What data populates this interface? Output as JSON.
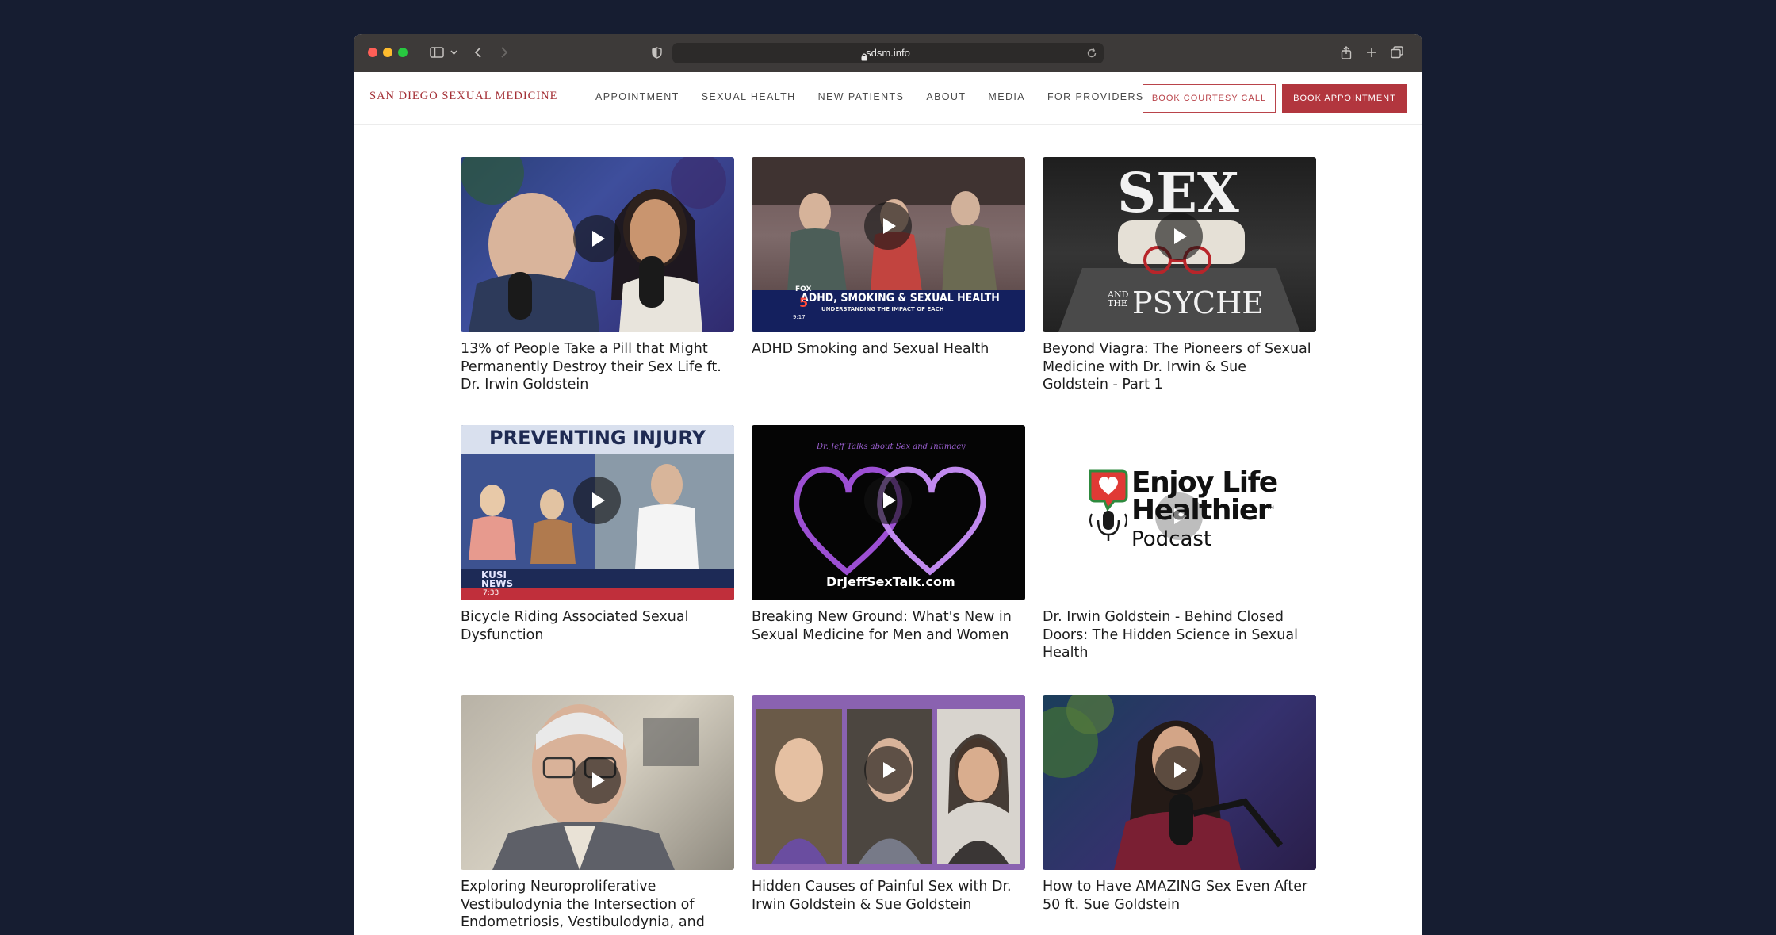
{
  "browser": {
    "url": "sdsm.info"
  },
  "site": {
    "logo": "SAN DIEGO SEXUAL MEDICINE",
    "menu": [
      "APPOINTMENT",
      "SEXUAL HEALTH",
      "NEW PATIENTS",
      "ABOUT",
      "MEDIA",
      "FOR PROVIDERS"
    ],
    "courtesy_call_label": "BOOK COURTESY CALL",
    "appointment_label": "BOOK APPOINTMENT"
  },
  "videos": [
    {
      "title": "13% of People Take a Pill that Might Permanently Destroy their Sex Life ft. Dr. Irwin Goldstein",
      "thumb_text": []
    },
    {
      "title": "ADHD Smoking and Sexual Health",
      "thumb_text": [
        "ADHD, SMOKING & SEXUAL HEALTH",
        "UNDERSTANDING THE IMPACT OF EACH",
        "FOX",
        "5",
        "9:17"
      ]
    },
    {
      "title": "Beyond Viagra: The Pioneers of Sexual Medicine with Dr. Irwin & Sue Goldstein - Part 1",
      "thumb_text": [
        "SEX",
        "AND THE",
        "PSYCHE"
      ]
    },
    {
      "title": "Bicycle Riding Associated Sexual Dysfunction",
      "thumb_text": [
        "PREVENTING INJURY",
        "KUSI NEWS",
        "7:33"
      ]
    },
    {
      "title": "Breaking New Ground: What's New in Sexual Medicine for Men and Women",
      "thumb_text": [
        "Dr. Jeff Talks about Sex and Intimacy",
        "DrJeffSexTalk.com"
      ]
    },
    {
      "title": "Dr. Irwin Goldstein - Behind Closed Doors: The Hidden Science in Sexual Health",
      "thumb_text": [
        "Enjoy Life",
        "Healthier",
        "Podcast",
        "TM"
      ]
    },
    {
      "title": "Exploring Neuroproliferative Vestibulodynia the Intersection of Endometriosis, Vestibulodynia, and",
      "thumb_text": []
    },
    {
      "title": "Hidden Causes of Painful Sex with Dr. Irwin Goldstein & Sue Goldstein",
      "thumb_text": []
    },
    {
      "title": "How to Have AMAZING Sex Even After 50 ft. Sue Goldstein",
      "thumb_text": []
    }
  ]
}
